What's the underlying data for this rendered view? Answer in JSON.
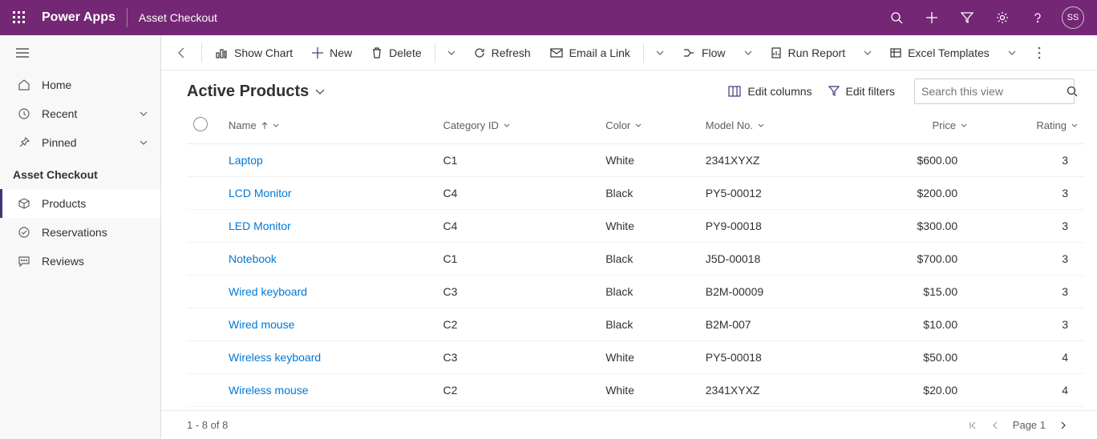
{
  "header": {
    "app_title": "Power Apps",
    "model_app": "Asset Checkout",
    "avatar_initials": "SS"
  },
  "sidebar": {
    "nav": {
      "home": "Home",
      "recent": "Recent",
      "pinned": "Pinned"
    },
    "section_title": "Asset Checkout",
    "items": [
      {
        "label": "Products"
      },
      {
        "label": "Reservations"
      },
      {
        "label": "Reviews"
      }
    ]
  },
  "commands": {
    "back": "Back",
    "show_chart": "Show Chart",
    "new": "New",
    "delete": "Delete",
    "refresh": "Refresh",
    "email_link": "Email a Link",
    "flow": "Flow",
    "run_report": "Run Report",
    "excel_templates": "Excel Templates"
  },
  "view": {
    "title": "Active Products",
    "edit_columns": "Edit columns",
    "edit_filters": "Edit filters",
    "search_placeholder": "Search this view"
  },
  "columns": {
    "name": "Name",
    "category": "Category ID",
    "color": "Color",
    "model": "Model No.",
    "price": "Price",
    "rating": "Rating"
  },
  "rows": [
    {
      "name": "Laptop",
      "category": "C1",
      "color": "White",
      "model": "2341XYXZ",
      "price": "$600.00",
      "rating": "3"
    },
    {
      "name": "LCD Monitor",
      "category": "C4",
      "color": "Black",
      "model": "PY5-00012",
      "price": "$200.00",
      "rating": "3"
    },
    {
      "name": "LED Monitor",
      "category": "C4",
      "color": "White",
      "model": "PY9-00018",
      "price": "$300.00",
      "rating": "3"
    },
    {
      "name": "Notebook",
      "category": "C1",
      "color": "Black",
      "model": "J5D-00018",
      "price": "$700.00",
      "rating": "3"
    },
    {
      "name": "Wired keyboard",
      "category": "C3",
      "color": "Black",
      "model": "B2M-00009",
      "price": "$15.00",
      "rating": "3"
    },
    {
      "name": "Wired mouse",
      "category": "C2",
      "color": "Black",
      "model": "B2M-007",
      "price": "$10.00",
      "rating": "3"
    },
    {
      "name": "Wireless keyboard",
      "category": "C3",
      "color": "White",
      "model": "PY5-00018",
      "price": "$50.00",
      "rating": "4"
    },
    {
      "name": "Wireless mouse",
      "category": "C2",
      "color": "White",
      "model": "2341XYXZ",
      "price": "$20.00",
      "rating": "4"
    }
  ],
  "footer": {
    "record_count": "1 - 8 of 8",
    "page_label": "Page 1"
  }
}
